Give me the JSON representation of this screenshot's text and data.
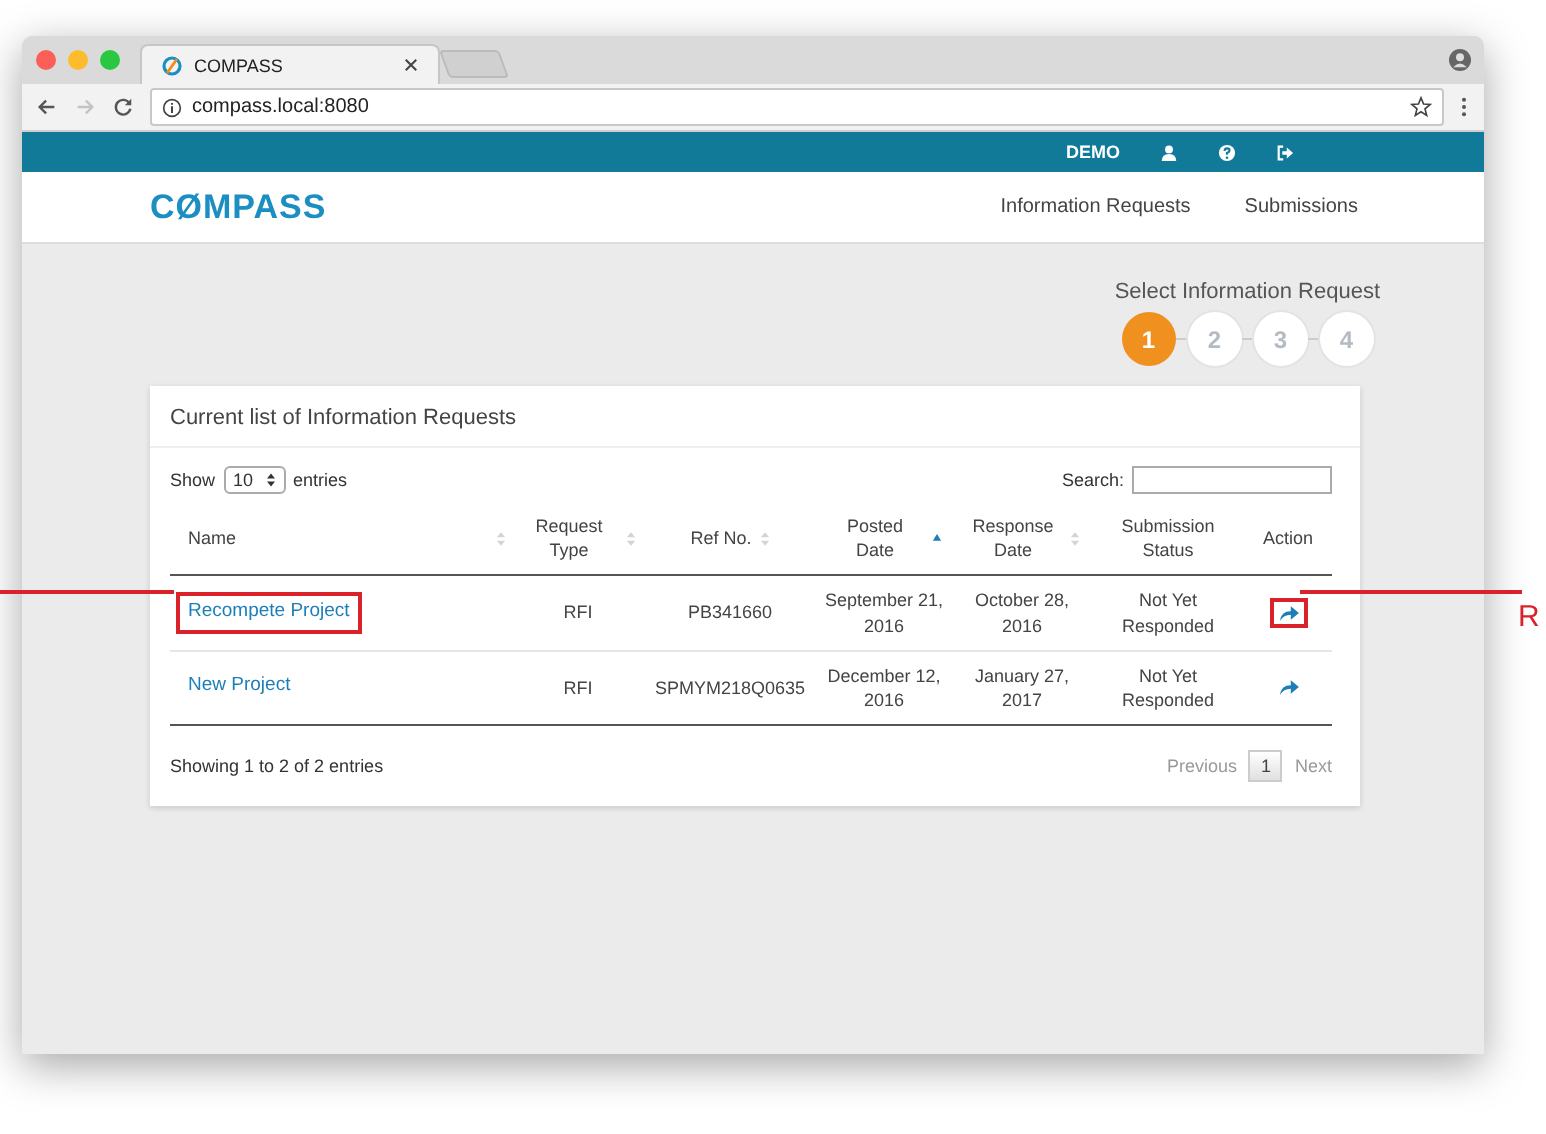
{
  "browser": {
    "tab_title": "COMPASS",
    "url": "compass.local:8080"
  },
  "top_bar": {
    "user": "DEMO"
  },
  "header": {
    "logo": "CØMPASS",
    "nav": [
      {
        "label": "Information Requests"
      },
      {
        "label": "Submissions"
      }
    ]
  },
  "wizard": {
    "title": "Select Information Request",
    "steps": [
      {
        "label": "1",
        "selected": true
      },
      {
        "label": "2",
        "selected": false
      },
      {
        "label": "3",
        "selected": false
      },
      {
        "label": "4",
        "selected": false
      }
    ]
  },
  "card": {
    "title": "Current list of Information Requests",
    "show_label": "Show",
    "page_size": "10",
    "entries_label": "entries",
    "search_label": "Search:",
    "columns": [
      {
        "label": "Name",
        "sortable": true,
        "sorted": false
      },
      {
        "label": "Request Type",
        "sortable": true,
        "sorted": false
      },
      {
        "label": "Ref No.",
        "sortable": true,
        "sorted": false
      },
      {
        "label": "Posted Date",
        "sortable": true,
        "sorted": true
      },
      {
        "label": "Response Date",
        "sortable": true,
        "sorted": false
      },
      {
        "label": "Submission Status",
        "sortable": false
      },
      {
        "label": "Action",
        "sortable": false
      }
    ],
    "rows": [
      {
        "name": "Recompete Project",
        "type": "RFI",
        "ref": "PB341660",
        "posted": "September 21, 2016",
        "response": "October 28, 2016",
        "status": "Not Yet Responded",
        "highlighted": true
      },
      {
        "name": "New Project",
        "type": "RFI",
        "ref": "SPMYM218Q0635",
        "posted": "December 12, 2016",
        "response": "January 27, 2017",
        "status": "Not Yet Responded",
        "highlighted": false
      }
    ],
    "info": "Showing 1 to 2 of 2 entries",
    "pagination": {
      "previous": "Previous",
      "pages": [
        {
          "label": "1",
          "selected": true
        }
      ],
      "next": "Next"
    }
  },
  "annotation": {
    "label": "R"
  }
}
